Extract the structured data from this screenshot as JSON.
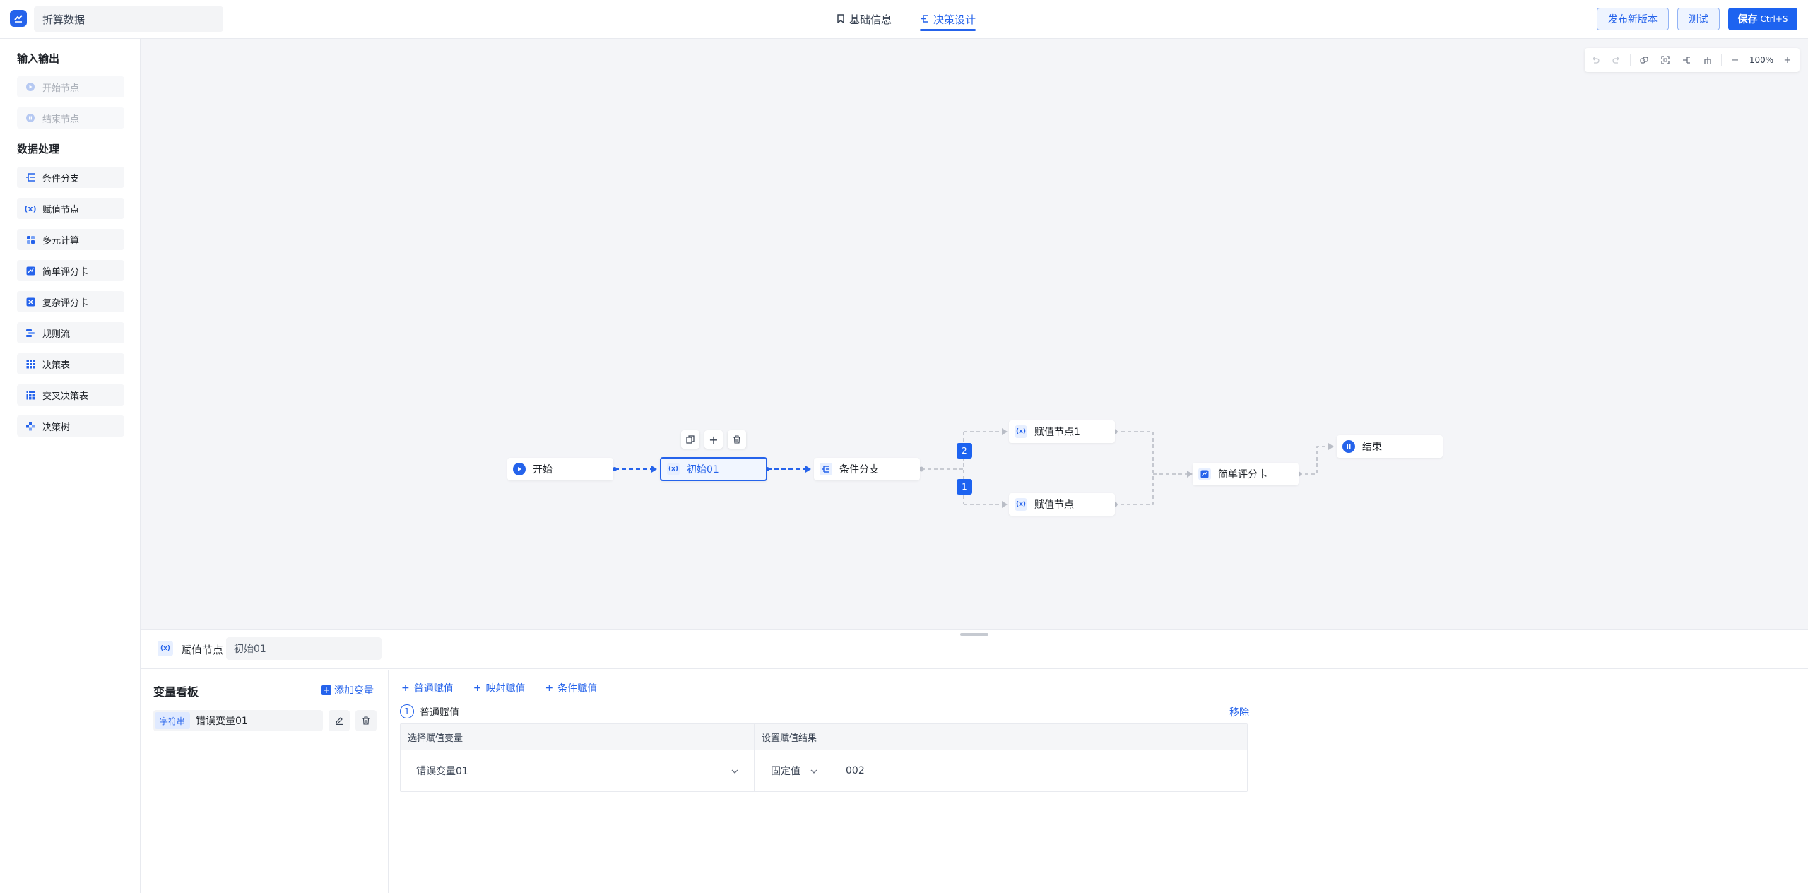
{
  "header": {
    "flow_name": "折算数据",
    "tabs": [
      {
        "label": "基础信息",
        "icon": "bookmark-icon",
        "active": false
      },
      {
        "label": "决策设计",
        "icon": "flow-icon",
        "active": true
      }
    ],
    "publish_label": "发布新版本",
    "test_label": "测试",
    "save_label": "保存",
    "save_shortcut": "Ctrl+S"
  },
  "palette": {
    "io_title": "输入输出",
    "io_items": [
      {
        "label": "开始节点",
        "icon": "play-icon"
      },
      {
        "label": "结束节点",
        "icon": "pause-icon"
      }
    ],
    "data_title": "数据处理",
    "data_items": [
      {
        "label": "条件分支",
        "icon": "branch-icon"
      },
      {
        "label": "赋值节点",
        "icon": "variable-icon"
      },
      {
        "label": "多元计算",
        "icon": "calc-icon"
      },
      {
        "label": "简单评分卡",
        "icon": "scorecard-icon"
      },
      {
        "label": "复杂评分卡",
        "icon": "complex-scorecard-icon"
      },
      {
        "label": "规则流",
        "icon": "ruleflow-icon"
      },
      {
        "label": "决策表",
        "icon": "table-icon"
      },
      {
        "label": "交叉决策表",
        "icon": "cross-table-icon"
      },
      {
        "label": "决策树",
        "icon": "tree-icon"
      }
    ]
  },
  "toolbar": {
    "zoom": "100%"
  },
  "canvas": {
    "nodes": {
      "start": "开始",
      "assign": "初始01",
      "branch": "条件分支",
      "assign1": "赋值节点1",
      "assign2": "赋值节点",
      "score": "简单评分卡",
      "end": "结束"
    },
    "badges": {
      "top": "2",
      "bottom": "1"
    }
  },
  "panel": {
    "node_type": "赋值节点",
    "node_name": "初始01",
    "var_board_title": "变量看板",
    "add_var_label": "添加变量",
    "variables": [
      {
        "type": "字符串",
        "name": "错误变量01"
      }
    ],
    "assign_tabs": [
      "普通赋值",
      "映射赋值",
      "条件赋值"
    ],
    "step_index": "1",
    "step_label": "普通赋值",
    "remove_label": "移除",
    "table": {
      "col1_header": "选择赋值变量",
      "col2_header": "设置赋值结果",
      "selected_var": "错误变量01",
      "value_type": "固定值",
      "value": "002"
    }
  }
}
